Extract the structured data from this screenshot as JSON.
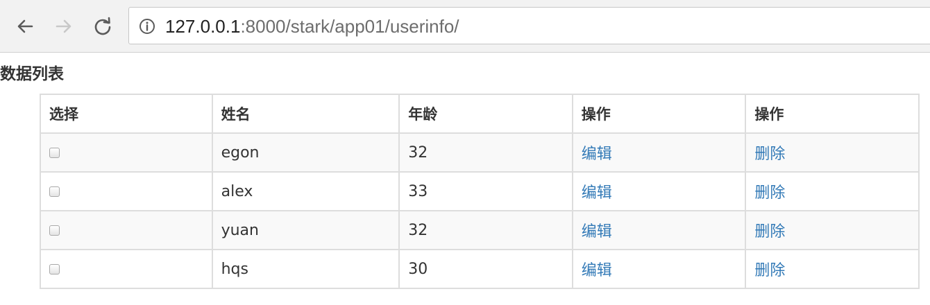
{
  "browser": {
    "url_host": "127.0.0.1",
    "url_rest": ":8000/stark/app01/userinfo/"
  },
  "icons": {
    "back": "arrow-left-icon",
    "forward": "arrow-right-icon",
    "reload": "reload-icon",
    "info": "info-icon"
  },
  "colors": {
    "link": "#337ab7",
    "forward_disabled": "#c8c8c8",
    "nav_enabled": "#5a5a5a"
  },
  "page": {
    "heading": "数据列表"
  },
  "table": {
    "headers": [
      "选择",
      "姓名",
      "年龄",
      "操作",
      "操作"
    ],
    "rows": [
      {
        "checked": false,
        "name": "egon",
        "age": "32",
        "edit": "编辑",
        "delete": "删除"
      },
      {
        "checked": false,
        "name": "alex",
        "age": "33",
        "edit": "编辑",
        "delete": "删除"
      },
      {
        "checked": false,
        "name": "yuan",
        "age": "32",
        "edit": "编辑",
        "delete": "删除"
      },
      {
        "checked": false,
        "name": "hqs",
        "age": "30",
        "edit": "编辑",
        "delete": "删除"
      }
    ]
  }
}
